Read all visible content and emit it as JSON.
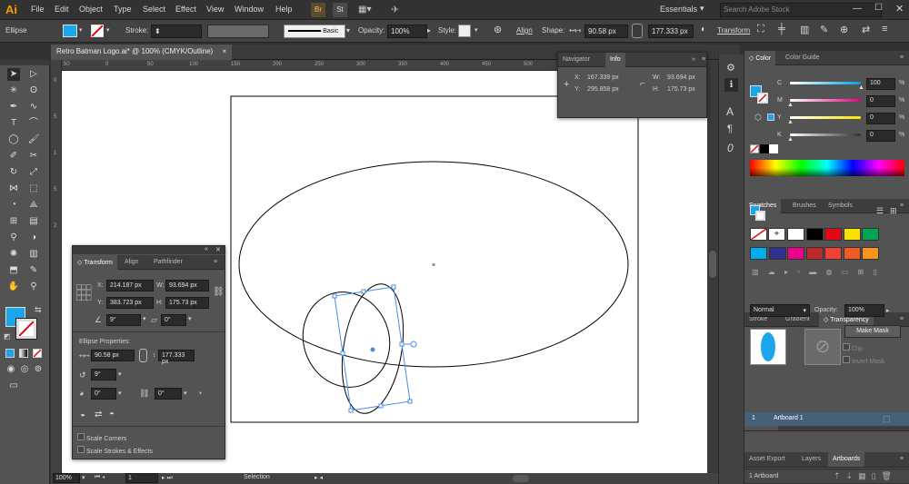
{
  "app": {
    "logo": "Ai"
  },
  "menu": [
    "File",
    "Edit",
    "Object",
    "Type",
    "Select",
    "Effect",
    "View",
    "Window",
    "Help"
  ],
  "menu_extras": {
    "bridge": "Br",
    "stock": "St",
    "workspace": "Essentials",
    "search_placeholder": "Search Adobe Stock"
  },
  "control": {
    "object_type": "Ellipse",
    "stroke_label": "Stroke:",
    "brush_label": "Basic",
    "opacity_label": "Opacity:",
    "opacity_value": "100%",
    "style_label": "Style:",
    "align_label": "Align",
    "shape_label": "Shape:",
    "shape_w": "90.58 px",
    "shape_h": "177.333 px",
    "transform_label": "Transform"
  },
  "document": {
    "tab_title": "Retro Batman Logo.ai* @ 100% (CMYK/Outline)",
    "close": "×"
  },
  "ruler_h": [
    "50",
    "0",
    "50",
    "100",
    "150",
    "200",
    "250",
    "300",
    "350",
    "400",
    "450",
    "500",
    "550",
    "600",
    "650",
    "700",
    "750"
  ],
  "ruler_v": [
    "0",
    "5",
    "1",
    "5",
    "2",
    "5",
    "3",
    "5",
    "4"
  ],
  "info_panel": {
    "tabs": [
      "Navigator",
      "Info"
    ],
    "x_label": "X:",
    "x": "167.339 px",
    "y_label": "Y:",
    "y": "295.858 px",
    "w_label": "W:",
    "w": "93.694 px",
    "h_label": "H:",
    "h": "175.73 px"
  },
  "transform_panel": {
    "tabs": [
      "Transform",
      "Align",
      "Pathfinder"
    ],
    "x_label": "X:",
    "x": "214.187 px",
    "w_label": "W:",
    "w": "93.694 px",
    "y_label": "Y:",
    "y": "383.723 px",
    "h_label": "H:",
    "h": "175.73 px",
    "rotate": "9°",
    "shear": "0°",
    "ellipse_heading": "Ellipse Properties:",
    "ellipse_w": "90.58 px",
    "ellipse_h": "177.333 px",
    "ellipse_angle": "9°",
    "corner1": "0°",
    "corner2": "0°",
    "scale_corners": "Scale Corners",
    "scale_strokes": "Scale Strokes & Effects"
  },
  "color_panel": {
    "tabs": [
      "Color",
      "Color Guide"
    ],
    "channels": [
      {
        "name": "C",
        "value": "100",
        "level": 1.0,
        "color": "#00a0e3"
      },
      {
        "name": "M",
        "value": "0",
        "level": 0.0,
        "color": "#e4007f"
      },
      {
        "name": "Y",
        "value": "0",
        "level": 0.0,
        "color": "#f5e400"
      },
      {
        "name": "K",
        "value": "0",
        "level": 0.0,
        "color": "#333333"
      }
    ],
    "pct": "%"
  },
  "swatches_panel": {
    "tabs": [
      "Swatches",
      "Brushes",
      "Symbols"
    ],
    "row1": [
      "#ffffff",
      "#000000",
      "#e30613",
      "#f9e000",
      "#00a651"
    ],
    "row2": [
      "#00aeef",
      "#2e3192",
      "#ec008c",
      "#c1272d",
      "#ef4136",
      "#f15a24",
      "#f7941d"
    ]
  },
  "transparency_panel": {
    "tabs": [
      "Stroke",
      "Gradient",
      "Transparency"
    ],
    "mode": "Normal",
    "opacity_label": "Opacity:",
    "opacity": "100%",
    "make_mask": "Make Mask",
    "clip": "Clip",
    "invert_mask": "Invert Mask"
  },
  "libraries_tabs": [
    "Libraries",
    "Appearance",
    "Graphic Styles"
  ],
  "artboards_panel": {
    "tabs": [
      "Asset Export",
      "Layers",
      "Artboards"
    ],
    "row_number": "1",
    "row_name": "Artboard 1",
    "footer": "1 Artboard"
  },
  "status": {
    "zoom": "100%",
    "page": "1",
    "tool": "Selection"
  },
  "colors": {
    "accent": "#1ba6ec",
    "selection": "#4a90e2",
    "fill": "#1ba6ec"
  }
}
